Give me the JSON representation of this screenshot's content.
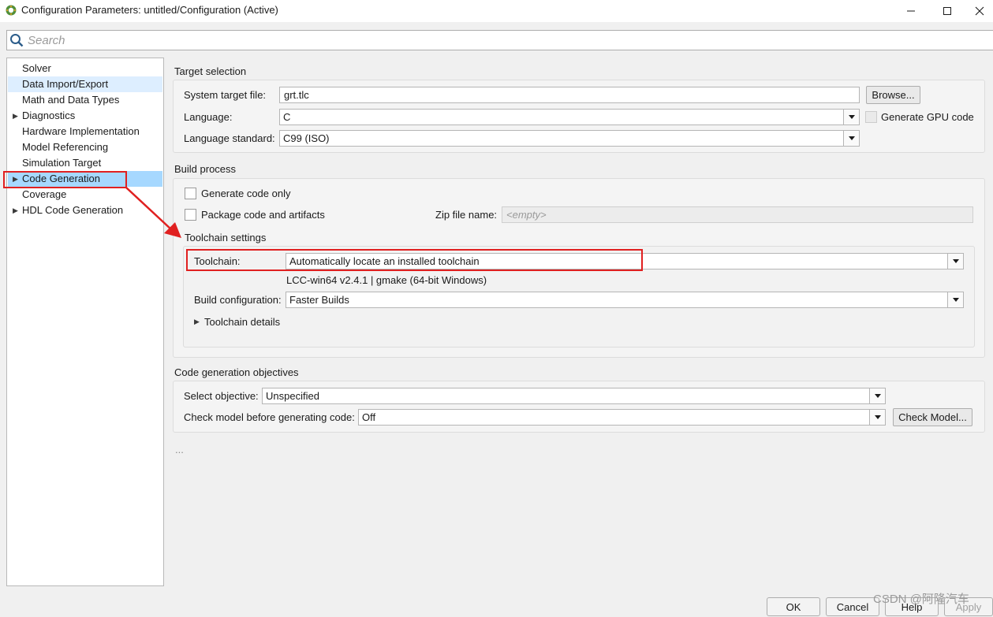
{
  "window": {
    "title": "Configuration Parameters: untitled/Configuration (Active)"
  },
  "search": {
    "placeholder": "Search"
  },
  "tree": {
    "items": [
      {
        "label": "Solver",
        "expandable": false
      },
      {
        "label": "Data Import/Export",
        "expandable": false
      },
      {
        "label": "Math and Data Types",
        "expandable": false
      },
      {
        "label": "Diagnostics",
        "expandable": true
      },
      {
        "label": "Hardware Implementation",
        "expandable": false
      },
      {
        "label": "Model Referencing",
        "expandable": false
      },
      {
        "label": "Simulation Target",
        "expandable": false
      },
      {
        "label": "Code Generation",
        "expandable": true,
        "selected": true
      },
      {
        "label": "Coverage",
        "expandable": false
      },
      {
        "label": "HDL Code Generation",
        "expandable": true
      }
    ]
  },
  "target_selection": {
    "title": "Target selection",
    "system_target_file_label": "System target file:",
    "system_target_file_value": "grt.tlc",
    "browse_label": "Browse...",
    "language_label": "Language:",
    "language_value": "C",
    "gpu_label": "Generate GPU code",
    "language_standard_label": "Language standard:",
    "language_standard_value": "C99 (ISO)"
  },
  "build_process": {
    "title": "Build process",
    "generate_code_only_label": "Generate code only",
    "package_label": "Package code and artifacts",
    "zip_label": "Zip file name:",
    "zip_placeholder": "<empty>"
  },
  "toolchain": {
    "title": "Toolchain settings",
    "toolchain_label": "Toolchain:",
    "toolchain_value": "Automatically locate an installed toolchain",
    "toolchain_info": "LCC-win64 v2.4.1 | gmake (64-bit Windows)",
    "build_config_label": "Build configuration:",
    "build_config_value": "Faster Builds",
    "details_label": "Toolchain details"
  },
  "objectives": {
    "title": "Code generation objectives",
    "select_objective_label": "Select objective:",
    "select_objective_value": "Unspecified",
    "check_model_label": "Check model before generating code:",
    "check_model_value": "Off",
    "check_model_button": "Check Model..."
  },
  "more": "...",
  "bottom": {
    "ok": "OK",
    "cancel": "Cancel",
    "help": "Help",
    "apply": "Apply"
  },
  "watermark": "CSDN @阿隆汽车",
  "colors": {
    "selection": "#a6d8ff",
    "annotation": "#e02020"
  }
}
